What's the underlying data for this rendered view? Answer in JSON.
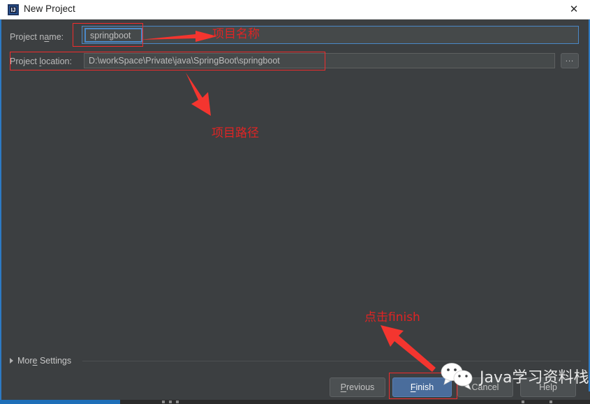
{
  "window": {
    "title": "New Project",
    "app_icon": "intellij-idea-icon",
    "close_label": "✕"
  },
  "form": {
    "name_label_pre": "Project n",
    "name_label_mnemonic": "a",
    "name_label_post": "me:",
    "name_label_full": "Project name:",
    "name_value": "springboot",
    "location_label_pre": "Project ",
    "location_label_mnemonic": "l",
    "location_label_post": "ocation:",
    "location_label_full": "Project location:",
    "location_value": "D:\\workSpace\\Private\\java\\SpringBoot\\springboot",
    "browse_label": "...",
    "browse_title": "browse-folder"
  },
  "more_settings": {
    "label_pre": "Mor",
    "label_mnemonic": "e",
    "label_post": " Settings",
    "label_full": "More Settings",
    "expanded": false
  },
  "buttons": {
    "previous_pre": "",
    "previous_mnemonic": "P",
    "previous_post": "revious",
    "previous_full": "Previous",
    "finish_pre": "",
    "finish_mnemonic": "F",
    "finish_post": "inish",
    "finish_full": "Finish",
    "cancel_full": "Cancel",
    "help_full": "Help"
  },
  "annotations": {
    "project_name": "项目名称",
    "project_path": "项目路径",
    "click_finish": "点击finish",
    "color": "#e02424"
  },
  "watermark": {
    "text": "Java学习资料栈",
    "icon": "wechat-icon"
  },
  "colors": {
    "dialog_bg": "#3c3f41",
    "field_bg": "#45494a",
    "accent_blue": "#2d7ac4",
    "primary_button": "#4a6d9c",
    "titlebar_bg": "#ffffff",
    "annotation_red": "#f22c2c"
  }
}
